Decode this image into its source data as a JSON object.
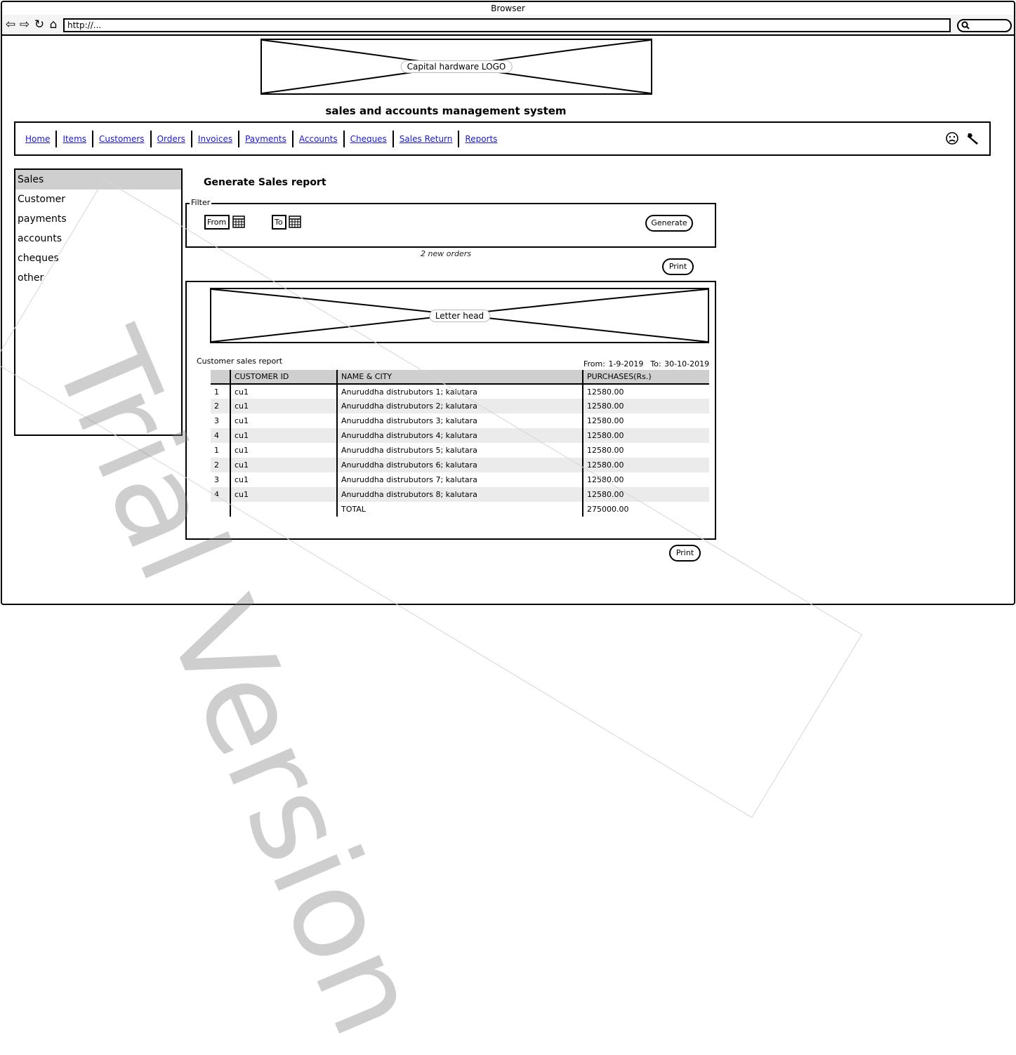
{
  "browser": {
    "title": "Browser",
    "url": "http://..."
  },
  "header": {
    "logo_label": "Capital hardware LOGO",
    "app_title": "sales and accounts management system"
  },
  "nav": {
    "links": [
      "Home",
      "Items",
      "Customers",
      "Orders",
      "Invoices",
      "Payments",
      "Accounts",
      "Cheques",
      "Sales Return",
      "Reports"
    ],
    "icons": [
      "frown-face-icon",
      "wrench-icon"
    ]
  },
  "sidebar": {
    "items": [
      "Sales",
      "Customer",
      "payments",
      "accounts",
      "cheques",
      "other"
    ],
    "active": "Sales"
  },
  "main": {
    "heading": "Generate Sales report",
    "filter": {
      "legend": "Filter",
      "from_label": "From",
      "to_label": "To",
      "generate_label": "Generate"
    },
    "new_orders_text": "2 new orders",
    "print_label": "Print"
  },
  "report": {
    "letterhead_label": "Letter head",
    "caption": "Customer sales report",
    "from_text": "From: 1-9-2019",
    "to_text": "To: 30-10-2019",
    "columns": [
      "",
      "CUSTOMER ID",
      "NAME & CITY",
      "PURCHASES(Rs.)"
    ],
    "rows": [
      [
        "1",
        "cu1",
        "Anuruddha distrubutors 1; kalutara",
        "12580.00"
      ],
      [
        "2",
        "cu1",
        "Anuruddha distrubutors 2; kalutara",
        "12580.00"
      ],
      [
        "3",
        "cu1",
        "Anuruddha distrubutors 3; kalutara",
        "12580.00"
      ],
      [
        "4",
        "cu1",
        "Anuruddha distrubutors 4; kalutara",
        "12580.00"
      ],
      [
        "1",
        "cu1",
        "Anuruddha distrubutors 5; kalutara",
        "12580.00"
      ],
      [
        "2",
        "cu1",
        "Anuruddha distrubutors 6; kalutara",
        "12580.00"
      ],
      [
        "3",
        "cu1",
        "Anuruddha distrubutors 7; kalutara",
        "12580.00"
      ],
      [
        "4",
        "cu1",
        "Anuruddha distrubutors 8; kalutara",
        "12580.00"
      ]
    ],
    "total_label": "TOTAL",
    "total_value": "275000.00"
  },
  "watermark": "Trial Version",
  "colors": {
    "link": "#1a18d8",
    "header_fill": "#cfcfcf",
    "stripe_fill": "#ebebeb"
  }
}
